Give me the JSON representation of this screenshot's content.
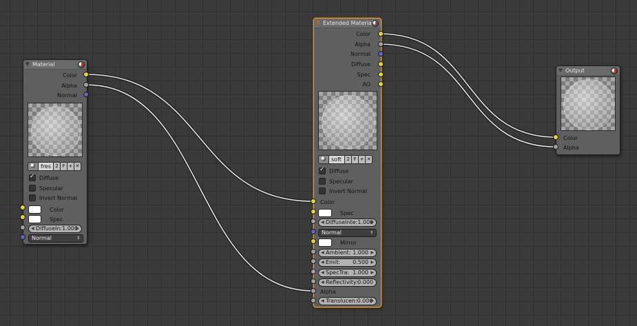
{
  "material_node": {
    "title": "Material",
    "outputs": [
      "Color",
      "Alpha",
      "Normal"
    ],
    "browse": {
      "name": "fres",
      "users": "2",
      "fake": "F"
    },
    "checkboxes": [
      {
        "label": "Diffuse",
        "checked": true
      },
      {
        "label": "Specular",
        "checked": false
      },
      {
        "label": "Invert Normal",
        "checked": false
      }
    ],
    "color_label": "Color",
    "spec_label": "Spec",
    "diffuse_field": "DiffuseIn:1.000",
    "normal_select": "Normal"
  },
  "extended_node": {
    "title": "Extended Material",
    "outputs": [
      "Color",
      "Alpha",
      "Normal",
      "Diffuse",
      "Spec",
      "AO"
    ],
    "browse": {
      "name": "soft",
      "users": "2",
      "fake": "F"
    },
    "checkboxes": [
      {
        "label": "Diffuse",
        "checked": true
      },
      {
        "label": "Specular",
        "checked": false
      },
      {
        "label": "Invert Normal",
        "checked": false
      }
    ],
    "color_label": "Color",
    "spec_label": "Spec",
    "diffuse_field": "DiffuseInte:1.000",
    "normal_select": "Normal",
    "mirror_label": "Mirror",
    "fields": [
      {
        "label": "Ambient:",
        "value": "1.000"
      },
      {
        "label": "Emit:",
        "value": "0.500"
      },
      {
        "label": "SpecTra:",
        "value": "1.000"
      },
      {
        "label": "Reflectivity:",
        "value": "0.000"
      }
    ],
    "alpha_label": "Alpha",
    "translucency_field": "Translucen:0.000"
  },
  "output_node": {
    "title": "Output",
    "inputs": [
      "Color",
      "Alpha"
    ]
  },
  "colors": {
    "socket_color": "#e3d63a",
    "socket_value": "#a2a2a2",
    "socket_vector": "#6363c8",
    "active_border": "#d89a40"
  }
}
